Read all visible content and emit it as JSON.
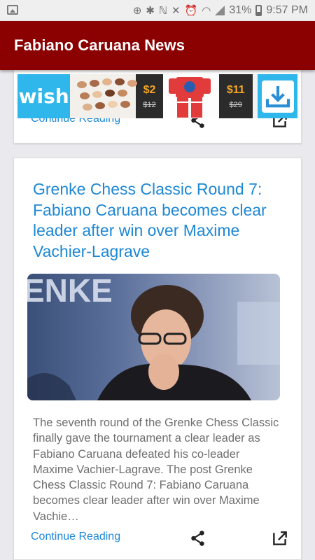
{
  "status_bar": {
    "battery": "31%",
    "time": "9:57 PM"
  },
  "app_bar": {
    "title": "Fabiano Caruana News"
  },
  "ad": {
    "brand": "wish",
    "price1_now": "$2",
    "price1_was": "$12",
    "price2_now": "$11",
    "price2_was": "$29"
  },
  "cards": [
    {
      "continue_label": "Continue Reading"
    },
    {
      "title": "Grenke Chess Classic Round 7: Fabiano Caruana becomes clear leader after win over Maxime Vachier-Lagrave",
      "excerpt": "The seventh round of the Grenke Chess Classic finally gave the tournament a clear leader as Fabiano Caruana defeated his co-leader Maxime Vachier-Lagrave. The post Grenke Chess Classic Round 7: Fabiano Caruana becomes clear leader after win over Maxime Vachie…",
      "continue_label": "Continue Reading"
    }
  ],
  "colors": {
    "app_bar": "#8b0000",
    "link": "#1e88d4",
    "wish": "#2fb7ec"
  }
}
